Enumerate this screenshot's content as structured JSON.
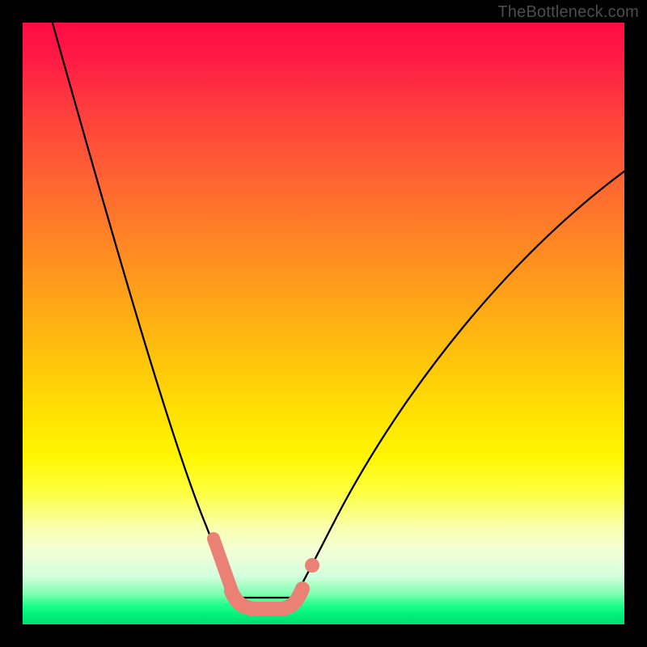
{
  "watermark": "TheBottleneck.com",
  "colors": {
    "gradient_top": "#ff0b45",
    "gradient_mid": "#fff600",
    "gradient_bottom": "#00dc72",
    "marker": "#eb8174",
    "curve": "#000000",
    "frame": "#000000"
  },
  "chart_data": {
    "type": "line",
    "title": "",
    "xlabel": "",
    "ylabel": "",
    "x_range_normalized": [
      0,
      1
    ],
    "y_range_percent": [
      0,
      100
    ],
    "description": "Bottleneck curve: percentage bottleneck (0 = green, 100 = red) as a function of a normalized hardware-balance axis. Minimum (~0%) occurs near x≈0.40; curve rises steeply toward 100% on the left edge and toward ~75% on the right edge.",
    "series": [
      {
        "name": "bottleneck_percent",
        "x": [
          0.05,
          0.1,
          0.15,
          0.2,
          0.25,
          0.3,
          0.34,
          0.37,
          0.4,
          0.43,
          0.46,
          0.5,
          0.55,
          0.62,
          0.7,
          0.8,
          0.9,
          1.0
        ],
        "values": [
          100,
          88,
          73,
          55,
          38,
          22,
          10,
          3,
          0,
          0,
          3,
          9,
          18,
          30,
          42,
          55,
          66,
          76
        ]
      }
    ],
    "highlight_band_x": [
      0.32,
      0.49
    ],
    "background_color_scale": {
      "axis": "y",
      "stops": [
        {
          "pct": 0,
          "color": "#00dc72"
        },
        {
          "pct": 8,
          "color": "#7cffb0"
        },
        {
          "pct": 15,
          "color": "#f2ffd8"
        },
        {
          "pct": 25,
          "color": "#fff600"
        },
        {
          "pct": 45,
          "color": "#ffc40b"
        },
        {
          "pct": 65,
          "color": "#ff8127"
        },
        {
          "pct": 85,
          "color": "#ff3b3e"
        },
        {
          "pct": 100,
          "color": "#ff0b45"
        }
      ]
    }
  }
}
